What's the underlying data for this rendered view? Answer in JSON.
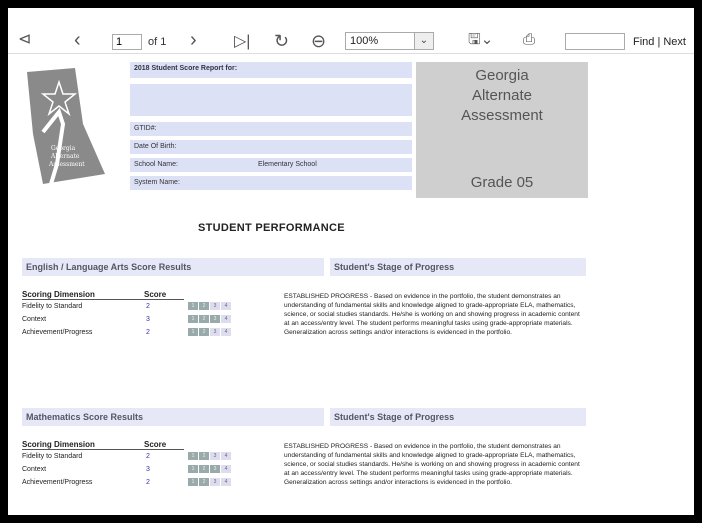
{
  "toolbar": {
    "page_value": "1",
    "page_of": "of 1",
    "zoom_value": "100%",
    "find_label": "Find | Next"
  },
  "header": {
    "report_for": "2018 Student Score Report for:",
    "gtid": "GTID#:",
    "dob": "Date Of Birth:",
    "school_name": "School Name:",
    "school_value": "Elementary School",
    "system_name": "System Name:",
    "assessment_line1": "Georgia",
    "assessment_line2": "Alternate",
    "assessment_line3": "Assessment",
    "grade": "Grade 05"
  },
  "title": "STUDENT PERFORMANCE",
  "sections": [
    {
      "heading": "English / Language Arts Score Results",
      "stage_heading": "Student's Stage of Progress",
      "col_dimension": "Scoring Dimension",
      "col_score": "Score",
      "rows": [
        {
          "label": "Fidelity to Standard",
          "score": "2"
        },
        {
          "label": "Context",
          "score": "3"
        },
        {
          "label": "Achievement/Progress",
          "score": "2"
        }
      ],
      "scale": [
        "1",
        "2",
        "3",
        "4"
      ],
      "progress_text": "ESTABLISHED PROGRESS - Based on evidence in the portfolio, the student demonstrates an understanding of fundamental skills and knowledge aligned to grade-appropriate ELA, mathematics, science, or social studies standards. He/she is working on and showing progress in academic content at an access/entry level. The student performs meaningful tasks using grade-appropriate materials. Generalization across settings and/or interactions is evidenced in the portfolio."
    },
    {
      "heading": "Mathematics Score Results",
      "stage_heading": "Student's Stage of Progress",
      "col_dimension": "Scoring Dimension",
      "col_score": "Score",
      "rows": [
        {
          "label": "Fidelity to Standard",
          "score": "2"
        },
        {
          "label": "Context",
          "score": "3"
        },
        {
          "label": "Achievement/Progress",
          "score": "2"
        }
      ],
      "scale": [
        "1",
        "2",
        "3",
        "4"
      ],
      "progress_text": "ESTABLISHED PROGRESS - Based on evidence in the portfolio, the student demonstrates an understanding of fundamental skills and knowledge aligned to grade-appropriate ELA, mathematics, science, or social studies standards. He/she is working on and showing progress in academic content at an access/entry level. The student performs meaningful tasks using grade-appropriate materials. Generalization across settings and/or interactions is evidenced in the portfolio."
    }
  ],
  "logo_text": [
    "Georgia",
    "Alternate",
    "Assessment"
  ]
}
